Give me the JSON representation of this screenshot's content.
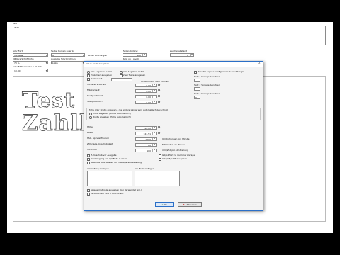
{
  "app": {
    "top": {
      "text_label": "Text",
      "text_value": "Zahl"
    },
    "row1": {
      "schriftart_label": "Schriftart",
      "schriftart_value": "Verdana",
      "kerning_label": "Selbst Kurven ruler zu",
      "kerning_value": "8",
      "linien_label": "Linien Rohrlängen",
      "zeilenabstand_label": "Zeilenabstand",
      "zeilenabstand_value": "100",
      "zeichenabstand_label": "Zeichenabstand",
      "zeichenabstand_value": "0"
    },
    "row2": {
      "mittlere_label": "Mittlere Schrifthöhe",
      "mittlere_value": "70 %",
      "ausgabe_label": "Ausgabe Schriftrichtung",
      "ausgabe_value": "Links",
      "italic_label": "Italic on / glyph",
      "gravur_label": "Gravur",
      "gravur_value": ""
    },
    "row3": {
      "schrift_label": "Schrifthöhe in der G-M Zeile",
      "schrift_value": "10.00"
    },
    "preview_lines": [
      "Test",
      "Zahll"
    ]
  },
  "dialog": {
    "title": "Als G-Code ausgeben",
    "close_glyph": "×",
    "radio_alle": "Alle Angaben in mm",
    "radio_zoll": "Alle Angaben in Zoll",
    "chk_einzelnen": "Einzelnen ausgeben",
    "chk_zwei": "zwei Texte ausgeben",
    "chk_punkte": "Punkte auf",
    "fields_left": [
      {
        "label": "Vorherer Z-Vorlauf",
        "value": "0.00"
      },
      {
        "label": "Fräskante Z",
        "value": "0.00"
      },
      {
        "label": "Startposition X",
        "value": "0.00"
      },
      {
        "label": "Startposition Y",
        "value": "0.00"
      }
    ],
    "groesse_label": "Größen nach dem Formatx",
    "right_col": {
      "chk_interne": "Benutze eigene konfigurierte Ausrichtungen",
      "satz1": "Satz 1 Vorlage benutzen",
      "satz2": "Satz 2 Vorlage benutzen",
      "satz3": "Satz 3 Vorlage benutzen",
      "satz3_value": "0"
    },
    "mid_group_title": "Höhe oder Breite angeben - die andere Länge wird automatisch berechnet",
    "radio_hoehe": "Höhe angeben (Breite automatisch)",
    "radio_breite": "Breite angeben (Höhe automatisch)",
    "fields_mid": [
      {
        "label": "Höhe",
        "value": "40.00"
      },
      {
        "label": "Breite",
        "value": "124.51"
      },
      {
        "label": "Hub. Spindel-Tourum",
        "value": "1000"
      },
      {
        "label": "Z-Vorlage-Vorschubgkeit",
        "value": "60"
      },
      {
        "label": "Vorschub",
        "value": "100"
      }
    ],
    "units_mid": [
      "Umdrehungen pro Minute",
      "Millimeter pro Minute",
      "mm/Zoll pro Umdrehung"
    ],
    "chk_rows": [
      {
        "label": "Z-Vorschub vor Ausgabe",
        "checked": true
      },
      {
        "label": "Verdrängung am X/Y-Ende G-Code",
        "checked": false
      },
      {
        "label": "Absolute Koordinaten für Ersatzgarantieleistung",
        "checked": false
      }
    ],
    "chk_rows_right": [
      {
        "label": "G0/G1/G2 ins nochmal Vorlage",
        "checked": false
      },
      {
        "label": "G02/G3/G4/T ausgeben",
        "checked": false
      }
    ],
    "text_anfang_label": "Am Anfang einfügen",
    "text_ende_label": "Am Ende einfügen",
    "chk_bottom": [
      {
        "label": "Spiegelmethode ausgeben (bei Verwendet wm.)",
        "checked": false
      },
      {
        "label": "Vertausche Y und Z Koordinate",
        "checked": false
      }
    ],
    "ok_label": "Ok",
    "cancel_label": "Abbrechen",
    "colors": {
      "accent": "#2b6fc7",
      "ok_check": "#2a8a2a",
      "cancel_x": "#c82828"
    }
  }
}
